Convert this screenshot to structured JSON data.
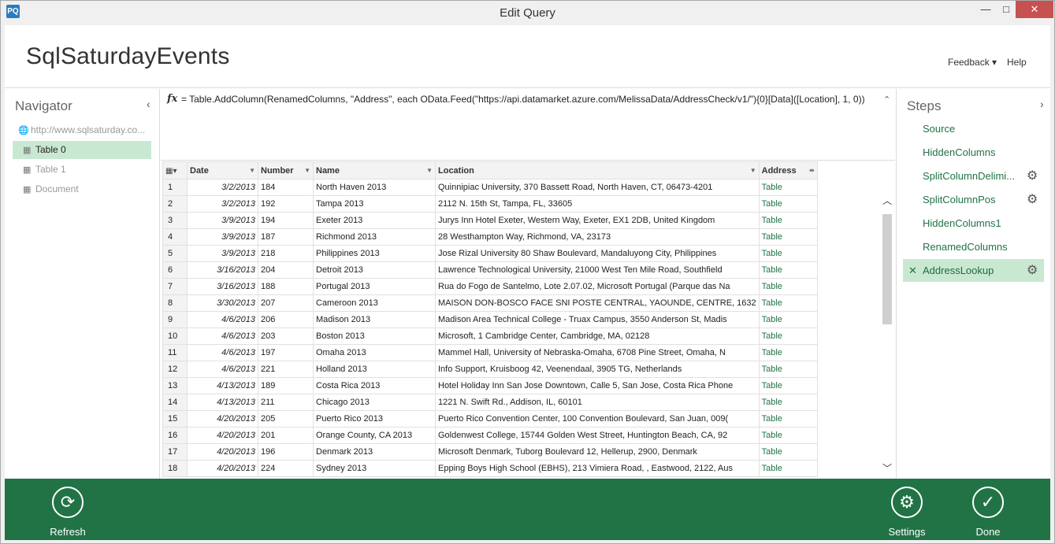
{
  "window": {
    "title": "Edit Query",
    "app_icon_label": "PQ",
    "minimize_glyph": "—",
    "maximize_glyph": "□",
    "close_glyph": "✕"
  },
  "header": {
    "query_name": "SqlSaturdayEvents",
    "feedback_label": "Feedback ▾",
    "help_label": "Help"
  },
  "navigator": {
    "title": "Navigator",
    "collapse_glyph": "‹",
    "root_url": "http://www.sqlsaturday.co...",
    "root_icon": "globe-icon",
    "items": [
      {
        "label": "Table 0",
        "icon": "table-icon"
      },
      {
        "label": "Table 1",
        "icon": "table-icon"
      },
      {
        "label": "Document",
        "icon": "table-icon"
      }
    ]
  },
  "formula": {
    "fx_label": "fx",
    "text": "= Table.AddColumn(RenamedColumns, \"Address\", each OData.Feed(\"https://api.datamarket.azure.com/MelissaData/AddressCheck/v1/\"){0}[Data]([Location], 1, 0))",
    "expand_glyph": "⌃"
  },
  "grid": {
    "columns": [
      "Date",
      "Number",
      "Name",
      "Location",
      "Address"
    ],
    "rows": [
      {
        "n": "1",
        "date": "3/2/2013",
        "number": "184",
        "name": "North Haven 2013",
        "location": "Quinnipiac University, 370 Bassett Road, North Haven, CT, 06473-4201",
        "address": "Table"
      },
      {
        "n": "2",
        "date": "3/2/2013",
        "number": "192",
        "name": "Tampa 2013",
        "location": "2112 N. 15th St, Tampa, FL, 33605",
        "address": "Table"
      },
      {
        "n": "3",
        "date": "3/9/2013",
        "number": "194",
        "name": "Exeter 2013",
        "location": "Jurys Inn Hotel Exeter, Western Way, Exeter, EX1 2DB, United Kingdom",
        "address": "Table"
      },
      {
        "n": "4",
        "date": "3/9/2013",
        "number": "187",
        "name": "Richmond 2013",
        "location": "28 Westhampton Way, Richmond, VA, 23173",
        "address": "Table"
      },
      {
        "n": "5",
        "date": "3/9/2013",
        "number": "218",
        "name": "Philippines 2013",
        "location": "Jose Rizal University 80 Shaw Boulevard, Mandaluyong City, Philippines",
        "address": "Table"
      },
      {
        "n": "6",
        "date": "3/16/2013",
        "number": "204",
        "name": "Detroit 2013",
        "location": "Lawrence Technological University, 21000 West Ten Mile Road, Southfield",
        "address": "Table"
      },
      {
        "n": "7",
        "date": "3/16/2013",
        "number": "188",
        "name": "Portugal 2013",
        "location": "Rua do Fogo de Santelmo, Lote 2.07.02, Microsoft Portugal (Parque das Na",
        "address": "Table"
      },
      {
        "n": "8",
        "date": "3/30/2013",
        "number": "207",
        "name": "Cameroon 2013",
        "location": "MAISON DON-BOSCO FACE SNI POSTE CENTRAL, YAOUNDE, CENTRE, 1632",
        "address": "Table"
      },
      {
        "n": "9",
        "date": "4/6/2013",
        "number": "206",
        "name": "Madison 2013",
        "location": "Madison Area Technical College - Truax Campus, 3550 Anderson St, Madis",
        "address": "Table"
      },
      {
        "n": "10",
        "date": "4/6/2013",
        "number": "203",
        "name": "Boston 2013",
        "location": "Microsoft, 1 Cambridge Center, Cambridge, MA, 02128",
        "address": "Table"
      },
      {
        "n": "11",
        "date": "4/6/2013",
        "number": "197",
        "name": "Omaha 2013",
        "location": "Mammel Hall, University of Nebraska-Omaha, 6708 Pine Street, Omaha, N",
        "address": "Table"
      },
      {
        "n": "12",
        "date": "4/6/2013",
        "number": "221",
        "name": "Holland 2013",
        "location": "Info Support, Kruisboog 42, Veenendaal, 3905 TG, Netherlands",
        "address": "Table"
      },
      {
        "n": "13",
        "date": "4/13/2013",
        "number": "189",
        "name": "Costa Rica 2013",
        "location": "Hotel Holiday Inn San Jose Downtown, Calle 5, San Jose, Costa Rica Phone",
        "address": "Table"
      },
      {
        "n": "14",
        "date": "4/13/2013",
        "number": "211",
        "name": "Chicago 2013",
        "location": "1221 N. Swift Rd., Addison, IL, 60101",
        "address": "Table"
      },
      {
        "n": "15",
        "date": "4/20/2013",
        "number": "205",
        "name": "Puerto Rico 2013",
        "location": "Puerto Rico Convention Center, 100 Convention Boulevard, San Juan, 009(",
        "address": "Table"
      },
      {
        "n": "16",
        "date": "4/20/2013",
        "number": "201",
        "name": "Orange County, CA 2013",
        "location": "Goldenwest College, 15744 Golden West Street, Huntington Beach, CA, 92",
        "address": "Table"
      },
      {
        "n": "17",
        "date": "4/20/2013",
        "number": "196",
        "name": "Denmark 2013",
        "location": "Microsoft Denmark, Tuborg Boulevard 12, Hellerup, 2900, Denmark",
        "address": "Table"
      },
      {
        "n": "18",
        "date": "4/20/2013",
        "number": "224",
        "name": "Sydney 2013",
        "location": "Epping Boys High School (EBHS), 213 Vimiera Road, , Eastwood, 2122, Aus",
        "address": "Table"
      }
    ]
  },
  "steps": {
    "title": "Steps",
    "collapse_glyph": "›",
    "items": [
      {
        "label": "Source",
        "gear": false
      },
      {
        "label": "HiddenColumns",
        "gear": false
      },
      {
        "label": "SplitColumnDelimi...",
        "gear": true
      },
      {
        "label": "SplitColumnPos",
        "gear": true
      },
      {
        "label": "HiddenColumns1",
        "gear": false
      },
      {
        "label": "RenamedColumns",
        "gear": false
      },
      {
        "label": "AddressLookup",
        "gear": true
      }
    ]
  },
  "bottom": {
    "refresh_label": "Refresh",
    "settings_label": "Settings",
    "done_label": "Done"
  },
  "colors": {
    "accent_green": "#217346",
    "selected_bg": "#c9e8d2",
    "close_red": "#c75050"
  }
}
